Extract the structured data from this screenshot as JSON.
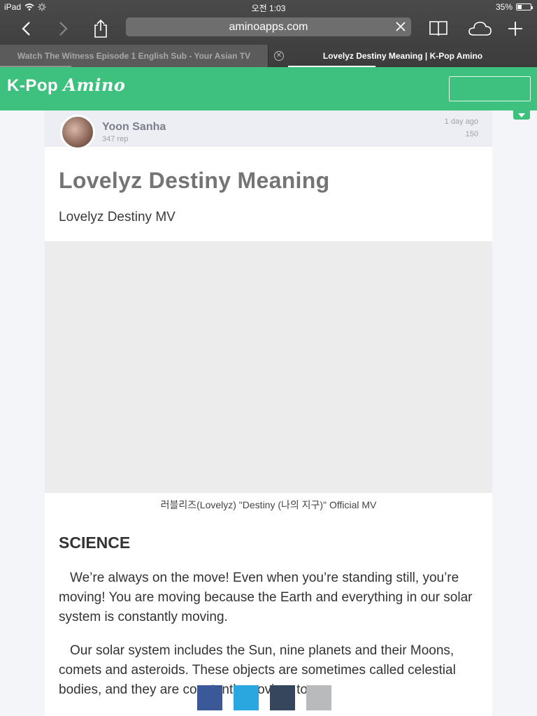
{
  "status_bar": {
    "device": "iPad",
    "time": "오전 1:03",
    "battery": "35%",
    "battery_level": 0.35
  },
  "browser": {
    "url": "aminoapps.com",
    "tabs": [
      {
        "title": "Watch The Witness Episode 1 English Sub - Your Asian TV",
        "active": false
      },
      {
        "title": "Lovelyz Destiny Meaning | K-Pop Amino",
        "active": true
      }
    ]
  },
  "app": {
    "logo_plain": "K-Pop ",
    "logo_script": "Amino",
    "brand_color": "#3ec17e"
  },
  "post": {
    "author": {
      "name": "Yoon Sanha",
      "rep": "347 rep"
    },
    "time": "1 day ago",
    "views": "150",
    "title": "Lovelyz Destiny Meaning",
    "subtitle": "Lovelyz Destiny MV",
    "video_caption": "러블리즈(Lovelyz) \"Destiny (나의 지구)\" Official MV",
    "section_heading": "SCIENCE",
    "paragraphs": [
      "We’re always on the move! Even when you’re standing still, you’re moving! You are moving because the Earth and everything in our solar system is constantly moving.",
      "Our solar system includes the Sun, nine planets and their Moons, comets and asteroids. These objects are sometimes called celestial bodies, and they are constantly moving, too."
    ]
  },
  "share_buttons": [
    {
      "name": "facebook",
      "color": "#3b5998"
    },
    {
      "name": "twitter",
      "color": "#2aa7df"
    },
    {
      "name": "tumblr",
      "color": "#36465d"
    },
    {
      "name": "more",
      "color": "#b9babc"
    }
  ]
}
